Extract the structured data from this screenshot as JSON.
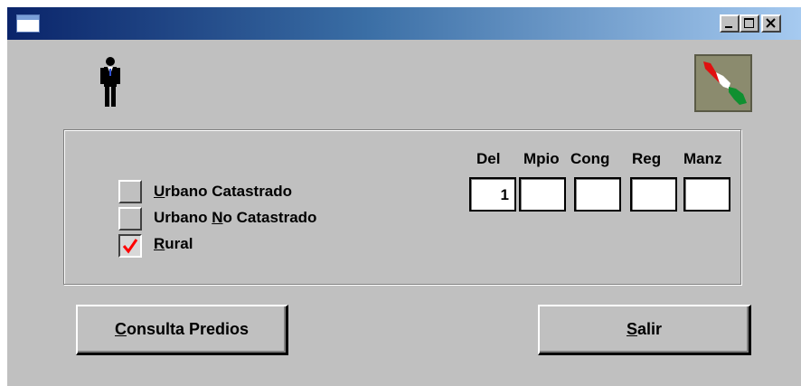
{
  "titlebar": {
    "title": "",
    "minimize_label": "_",
    "maximize_label": "□",
    "close_label": "×"
  },
  "icons": {
    "person": "person-icon",
    "map": "map-icon"
  },
  "options": {
    "urbano_catastrado": {
      "label_first": "U",
      "label_rest": "rbano Catastrado",
      "checked": false
    },
    "urbano_no_catastrado": {
      "label_pre": "Urbano ",
      "label_ul": "N",
      "label_post": "o Catastrado",
      "checked": false
    },
    "rural": {
      "label_first": "R",
      "label_rest": "ural",
      "checked": true
    }
  },
  "fields": {
    "del": {
      "header": "Del",
      "value": "1"
    },
    "mpio": {
      "header": "Mpio",
      "value": ""
    },
    "cong": {
      "header": "Cong",
      "value": ""
    },
    "reg": {
      "header": "Reg",
      "value": ""
    },
    "manz": {
      "header": "Manz",
      "value": ""
    }
  },
  "buttons": {
    "consulta": {
      "label_first": "C",
      "label_rest": "onsulta Predios"
    },
    "salir": {
      "label_first": "S",
      "label_rest": "alir"
    }
  },
  "colors": {
    "check_mark": "#ff0000",
    "titlebar_start": "#0a246a",
    "titlebar_end": "#a6caf0",
    "face": "#c0c0c0"
  }
}
